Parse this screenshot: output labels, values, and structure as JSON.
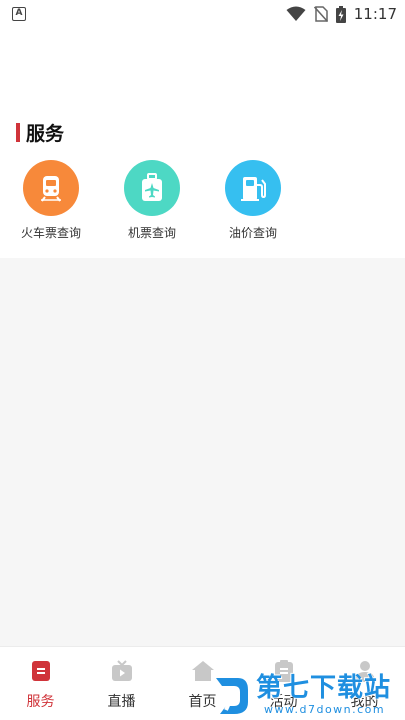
{
  "status_bar": {
    "notification_letter": "A",
    "time": "11:17",
    "icons": [
      "wifi-icon",
      "no-sim-icon",
      "battery-charging-icon"
    ]
  },
  "section": {
    "title": "服务"
  },
  "services": [
    {
      "label": "火车票查询",
      "icon": "train-icon",
      "color": "#f7893a"
    },
    {
      "label": "机票查询",
      "icon": "plane-ticket-icon",
      "color": "#4dd8c4"
    },
    {
      "label": "油价查询",
      "icon": "fuel-pump-icon",
      "color": "#36bff0"
    }
  ],
  "tabs": [
    {
      "label": "服务",
      "icon": "service-icon",
      "active": true
    },
    {
      "label": "直播",
      "icon": "tv-icon",
      "active": false
    },
    {
      "label": "首页",
      "icon": "home-icon",
      "active": false
    },
    {
      "label": "活动",
      "icon": "clipboard-icon",
      "active": false
    },
    {
      "label": "我的",
      "icon": "user-icon",
      "active": false
    }
  ],
  "colors": {
    "accent": "#d0343a",
    "tab_inactive": "#c8c8c8",
    "background": "#f6f6f6"
  },
  "watermark": {
    "title": "第七下载站",
    "url": "www.d7down.com"
  }
}
